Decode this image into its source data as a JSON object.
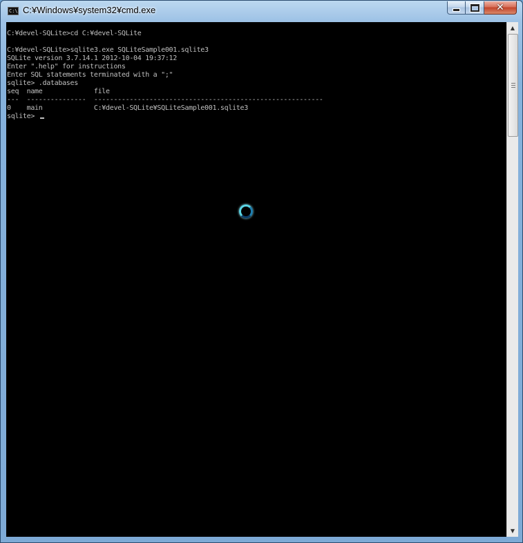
{
  "window": {
    "title": "C:¥Windows¥system32¥cmd.exe",
    "icon": "console-app-icon",
    "icon_text": "C:\\.",
    "controls": {
      "minimize": "minimize-icon",
      "maximize": "maximize-icon",
      "close": "close-icon",
      "close_glyph": "✕"
    }
  },
  "console": {
    "lines": [
      "C:¥devel-SQLite>cd C:¥devel-SQLite",
      "",
      "C:¥devel-SQLite>sqlite3.exe SQLiteSample001.sqlite3",
      "SQLite version 3.7.14.1 2012-10-04 19:37:12",
      "Enter \".help\" for instructions",
      "Enter SQL statements terminated with a \";\"",
      "sqlite> .databases",
      "seq  name             file",
      "---  ---------------  ----------------------------------------------------------",
      "0    main             C:¥devel-SQLite¥SQLiteSample001.sqlite3"
    ],
    "prompt": "sqlite> ",
    "colors": {
      "background": "#000000",
      "foreground": "#c0c0c0"
    }
  },
  "busy_indicator": "loading-spinner-icon",
  "scrollbar": {
    "up_arrow": "▲",
    "down_arrow": "▼"
  }
}
